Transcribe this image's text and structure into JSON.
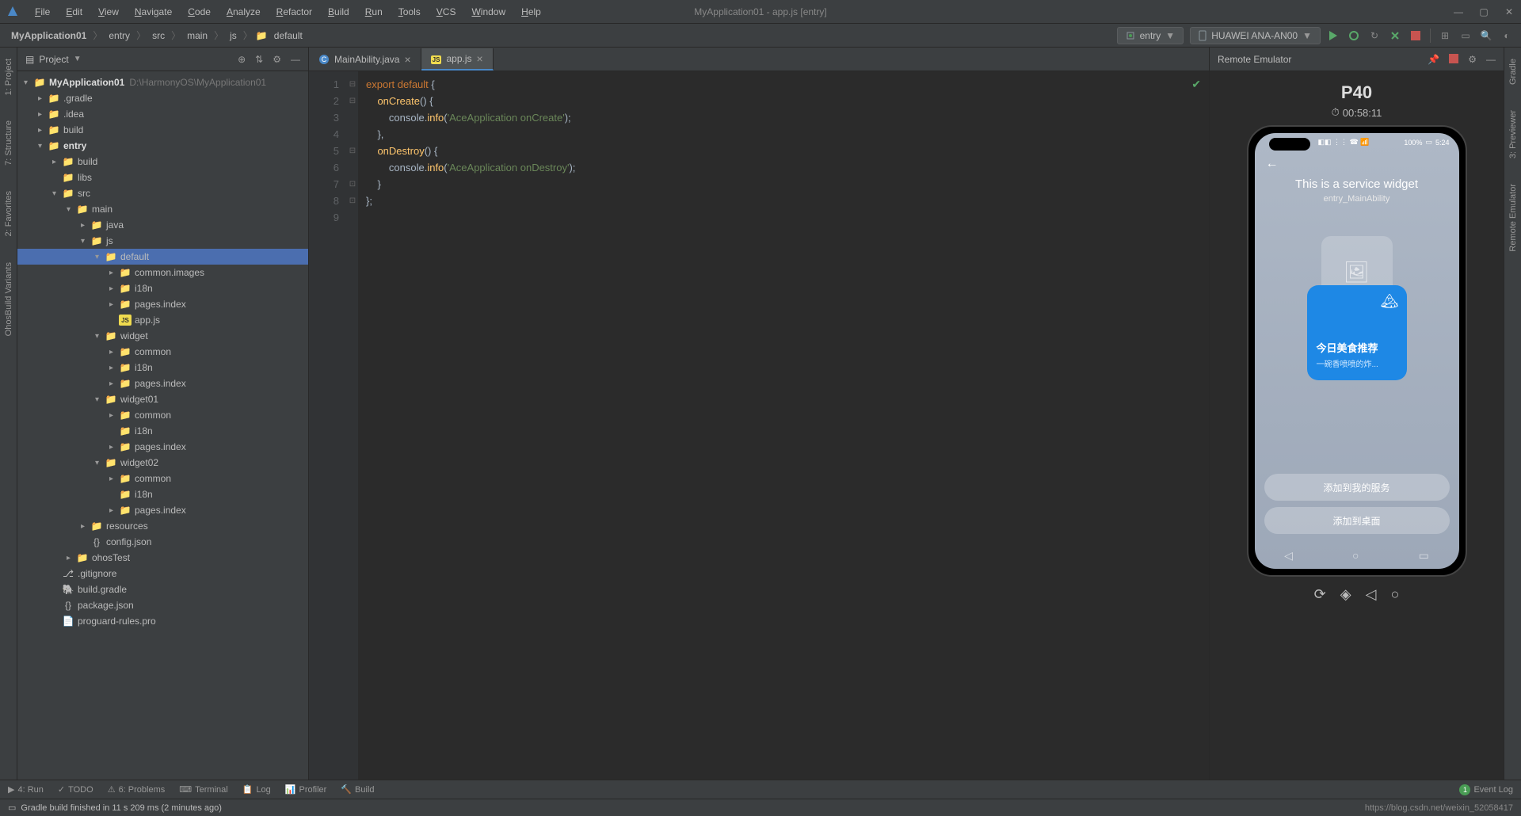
{
  "window": {
    "title": "MyApplication01 - app.js [entry]"
  },
  "menu": [
    "File",
    "Edit",
    "View",
    "Navigate",
    "Code",
    "Analyze",
    "Refactor",
    "Build",
    "Run",
    "Tools",
    "VCS",
    "Window",
    "Help"
  ],
  "breadcrumbs": [
    "MyApplication01",
    "entry",
    "src",
    "main",
    "js",
    "default"
  ],
  "toolbar": {
    "config": "entry",
    "device": "HUAWEI ANA-AN00"
  },
  "project_panel": {
    "title": "Project",
    "root": {
      "name": "MyApplication01",
      "path": "D:\\HarmonyOS\\MyApplication01"
    },
    "tree": [
      {
        "indent": 1,
        "arrow": "▸",
        "icon": "folder-orange",
        "label": ".gradle"
      },
      {
        "indent": 1,
        "arrow": "▸",
        "icon": "folder",
        "label": ".idea"
      },
      {
        "indent": 1,
        "arrow": "▸",
        "icon": "folder-orange",
        "label": "build"
      },
      {
        "indent": 1,
        "arrow": "▾",
        "icon": "folder-orange",
        "label": "entry",
        "bold": true
      },
      {
        "indent": 2,
        "arrow": "▸",
        "icon": "folder-orange",
        "label": "build"
      },
      {
        "indent": 2,
        "arrow": "",
        "icon": "folder",
        "label": "libs"
      },
      {
        "indent": 2,
        "arrow": "▾",
        "icon": "folder",
        "label": "src"
      },
      {
        "indent": 3,
        "arrow": "▾",
        "icon": "folder",
        "label": "main"
      },
      {
        "indent": 4,
        "arrow": "▸",
        "icon": "folder-blue",
        "label": "java"
      },
      {
        "indent": 4,
        "arrow": "▾",
        "icon": "folder-blue",
        "label": "js"
      },
      {
        "indent": 5,
        "arrow": "▾",
        "icon": "folder",
        "label": "default",
        "selected": true
      },
      {
        "indent": 6,
        "arrow": "▸",
        "icon": "folder",
        "label": "common.images"
      },
      {
        "indent": 6,
        "arrow": "▸",
        "icon": "folder",
        "label": "i18n"
      },
      {
        "indent": 6,
        "arrow": "▸",
        "icon": "folder",
        "label": "pages.index"
      },
      {
        "indent": 6,
        "arrow": "",
        "icon": "js",
        "label": "app.js"
      },
      {
        "indent": 5,
        "arrow": "▾",
        "icon": "folder",
        "label": "widget"
      },
      {
        "indent": 6,
        "arrow": "▸",
        "icon": "folder",
        "label": "common"
      },
      {
        "indent": 6,
        "arrow": "▸",
        "icon": "folder",
        "label": "i18n"
      },
      {
        "indent": 6,
        "arrow": "▸",
        "icon": "folder",
        "label": "pages.index"
      },
      {
        "indent": 5,
        "arrow": "▾",
        "icon": "folder",
        "label": "widget01"
      },
      {
        "indent": 6,
        "arrow": "▸",
        "icon": "folder",
        "label": "common"
      },
      {
        "indent": 6,
        "arrow": "",
        "icon": "folder",
        "label": "i18n"
      },
      {
        "indent": 6,
        "arrow": "▸",
        "icon": "folder",
        "label": "pages.index"
      },
      {
        "indent": 5,
        "arrow": "▾",
        "icon": "folder",
        "label": "widget02"
      },
      {
        "indent": 6,
        "arrow": "▸",
        "icon": "folder",
        "label": "common"
      },
      {
        "indent": 6,
        "arrow": "",
        "icon": "folder",
        "label": "i18n"
      },
      {
        "indent": 6,
        "arrow": "▸",
        "icon": "folder",
        "label": "pages.index"
      },
      {
        "indent": 4,
        "arrow": "▸",
        "icon": "folder",
        "label": "resources"
      },
      {
        "indent": 4,
        "arrow": "",
        "icon": "json",
        "label": "config.json"
      },
      {
        "indent": 3,
        "arrow": "▸",
        "icon": "folder",
        "label": "ohosTest"
      },
      {
        "indent": 2,
        "arrow": "",
        "icon": "git",
        "label": ".gitignore"
      },
      {
        "indent": 2,
        "arrow": "",
        "icon": "gradle",
        "label": "build.gradle"
      },
      {
        "indent": 2,
        "arrow": "",
        "icon": "json",
        "label": "package.json"
      },
      {
        "indent": 2,
        "arrow": "",
        "icon": "file",
        "label": "proguard-rules.pro"
      }
    ]
  },
  "tabs": [
    {
      "label": "MainAbility.java",
      "icon": "java",
      "active": false
    },
    {
      "label": "app.js",
      "icon": "js",
      "active": true
    }
  ],
  "code": {
    "lines": [
      1,
      2,
      3,
      4,
      5,
      6,
      7,
      8,
      9
    ],
    "text": "export default {\n    onCreate() {\n        console.info('AceApplication onCreate');\n    },\n    onDestroy() {\n        console.info('AceApplication onDestroy');\n    }\n};\n"
  },
  "emulator": {
    "title": "Remote Emulator",
    "device": "P40",
    "time": "00:58:11",
    "status_time": "5:24",
    "battery": "100%",
    "widget_title": "This is a service widget",
    "widget_sub": "entry_MainAbility",
    "card_title": "今日美食推荐",
    "card_sub": "一碗香喷喷的炸...",
    "btn1": "添加到我的服务",
    "btn2": "添加到桌面"
  },
  "bottom_tabs": [
    "4: Run",
    "TODO",
    "6: Problems",
    "Terminal",
    "Log",
    "Profiler",
    "Build"
  ],
  "event_log": "Event Log",
  "status": {
    "msg": "Gradle build finished in 11 s 209 ms (2 minutes ago)",
    "right": "https://blog.csdn.net/weixin_52058417"
  },
  "left_gutters": [
    "1: Project",
    "7: Structure",
    "2: Favorites",
    "OhosBuild Variants"
  ],
  "right_gutters": [
    "Gradle",
    "3: Previewer",
    "Remote Emulator"
  ]
}
